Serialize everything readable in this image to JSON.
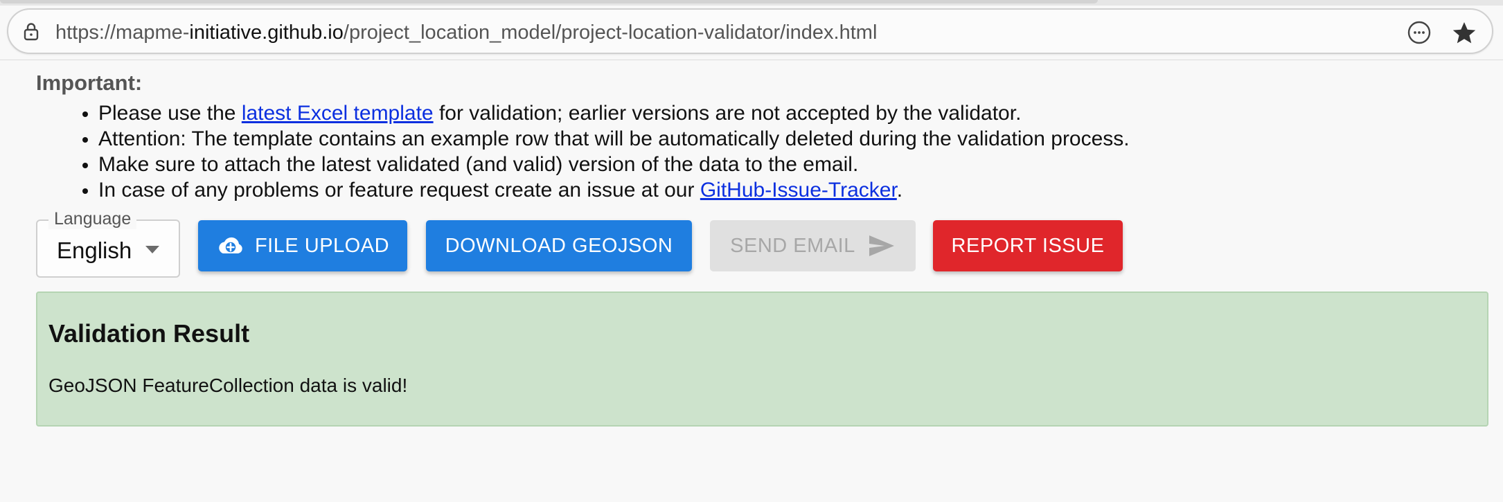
{
  "browser": {
    "url": {
      "scheme": "https://",
      "subdomain": "mapme-",
      "host": "initiative.github.io",
      "path": "/project_location_model/project-location-validator/index.html"
    },
    "icons": {
      "lock": "lock-icon",
      "page_info": "emoji-icon",
      "bookmark": "star-icon"
    }
  },
  "notice": {
    "heading": "Important:",
    "items": [
      {
        "before": "Please use the ",
        "link": "latest Excel template",
        "after": " for validation; earlier versions are not accepted by the validator."
      },
      {
        "text": "Attention: The template contains an example row that will be automatically deleted during the validation process."
      },
      {
        "text": "Make sure to attach the latest validated (and valid) version of the data to the email."
      },
      {
        "before": "In case of any problems or feature request create an issue at our ",
        "link": "GitHub-Issue-Tracker",
        "after": "."
      }
    ]
  },
  "controls": {
    "language": {
      "label": "Language",
      "value": "English"
    },
    "buttons": {
      "upload": "FILE UPLOAD",
      "download": "DOWNLOAD GEOJSON",
      "email": "SEND EMAIL",
      "report": "REPORT ISSUE"
    },
    "colors": {
      "primary": "#1f7ee0",
      "danger": "#e0262b",
      "disabled_bg": "#e0e0e0",
      "disabled_text": "#a7a7a7",
      "success_bg": "#cde3cc",
      "link": "#0b2fe0"
    }
  },
  "result": {
    "title": "Validation Result",
    "message": "GeoJSON FeatureCollection data is valid!"
  }
}
